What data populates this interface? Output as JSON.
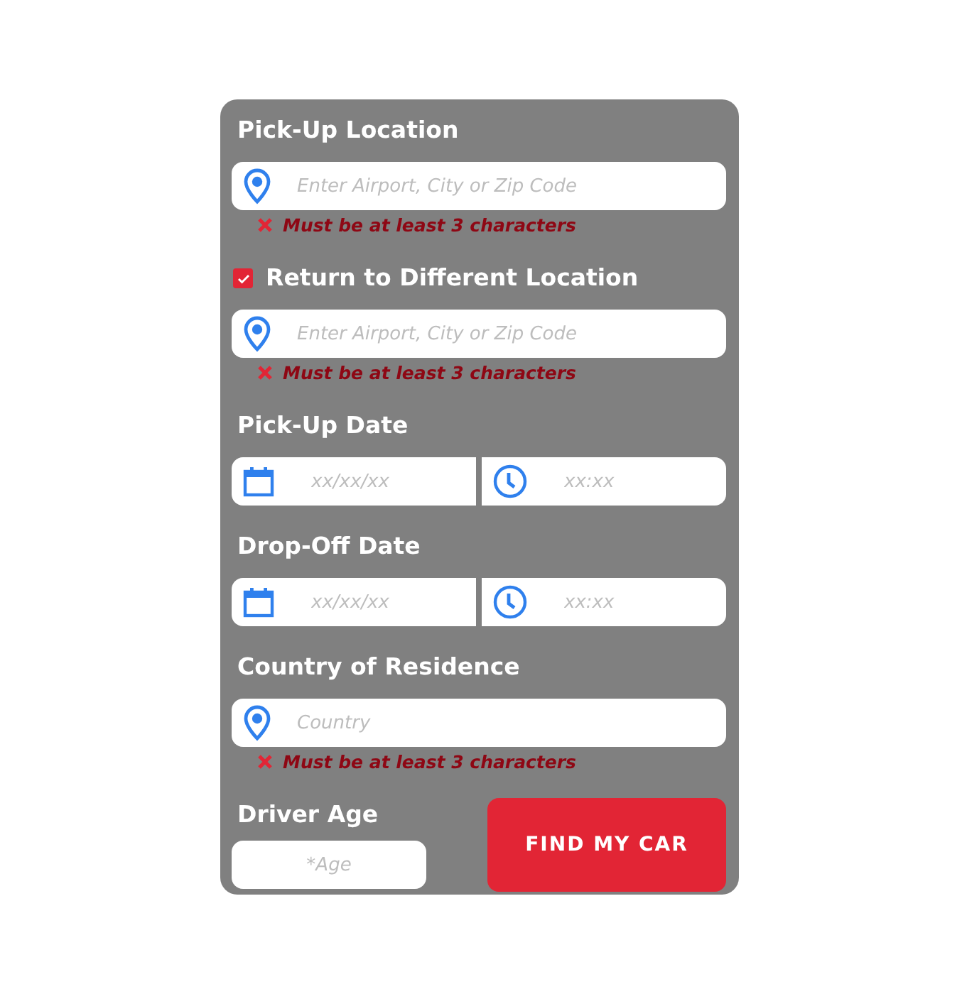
{
  "pickup_location": {
    "label": "Pick-Up Location",
    "placeholder": "Enter Airport, City or Zip Code",
    "error": "Must be at least 3 characters"
  },
  "return_location": {
    "label": "Return to Different Location",
    "checked": true,
    "placeholder": "Enter Airport, City or Zip Code",
    "error": "Must be at least 3 characters"
  },
  "pickup_date": {
    "label": "Pick-Up Date",
    "date_placeholder": "xx/xx/xx",
    "time_placeholder": "xx:xx"
  },
  "dropoff_date": {
    "label": "Drop-Off Date",
    "date_placeholder": "xx/xx/xx",
    "time_placeholder": "xx:xx"
  },
  "country": {
    "label": "Country of Residence",
    "placeholder": "Country",
    "error": "Must be at least 3 characters"
  },
  "driver_age": {
    "label": "Driver Age",
    "placeholder": "*Age"
  },
  "submit_button": "FIND MY CAR"
}
